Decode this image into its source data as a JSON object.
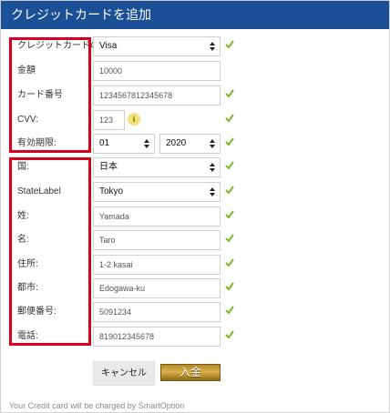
{
  "header": {
    "title": "クレジットカードを追加"
  },
  "colors": {
    "header_bg": "#1b4f96",
    "highlight_box": "#d8001c",
    "check": "#7ab828",
    "deposit_gold": "#c9a032"
  },
  "fields": {
    "card_type": {
      "label": "クレジットカードの種類",
      "value": "Visa"
    },
    "amount": {
      "label": "金額",
      "value": "10000"
    },
    "card_number": {
      "label": "カード番号",
      "value": "1234567812345678"
    },
    "cvv": {
      "label": "CVV:",
      "value": "123",
      "info": "i"
    },
    "expiry": {
      "label": "有効期限:",
      "month": "01",
      "year": "2020"
    },
    "country": {
      "label": "国:",
      "value": "日本"
    },
    "state": {
      "label": "StateLabel",
      "value": "Tokyo"
    },
    "last_name": {
      "label": "姓:",
      "value": "Yamada"
    },
    "first_name": {
      "label": "名:",
      "value": "Taro"
    },
    "address": {
      "label": "住所:",
      "value": "1-2 kasai"
    },
    "city": {
      "label": "都市:",
      "value": "Edogawa-ku"
    },
    "postal_code": {
      "label": "郵便番号:",
      "value": "5091234"
    },
    "phone": {
      "label": "電話:",
      "value": "819012345678"
    }
  },
  "buttons": {
    "cancel": "キャンセル",
    "deposit": "入金"
  },
  "footer": {
    "text": "Your Credit card will be charged by SmartOption"
  }
}
